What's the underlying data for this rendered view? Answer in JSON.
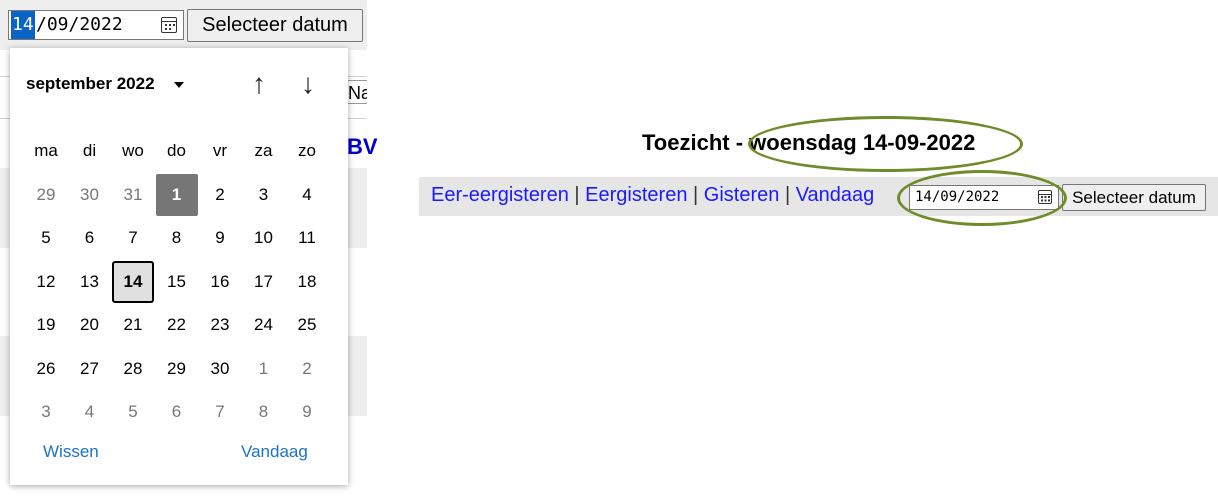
{
  "date_input": {
    "day_segment": "14",
    "rest_segments": "/09/2022"
  },
  "select_button_label": "Selecteer datum",
  "peek_texts": {
    "na": "Na",
    "bw": "BV"
  },
  "calendar": {
    "month_label": "september 2022",
    "weekdays": [
      "ma",
      "di",
      "wo",
      "do",
      "vr",
      "za",
      "zo"
    ],
    "weeks": [
      [
        {
          "d": "29",
          "other": true
        },
        {
          "d": "30",
          "other": true
        },
        {
          "d": "31",
          "other": true
        },
        {
          "d": "1",
          "selected": true
        },
        {
          "d": "2"
        },
        {
          "d": "3"
        },
        {
          "d": "4"
        }
      ],
      [
        {
          "d": "5"
        },
        {
          "d": "6"
        },
        {
          "d": "7"
        },
        {
          "d": "8"
        },
        {
          "d": "9"
        },
        {
          "d": "10"
        },
        {
          "d": "11"
        }
      ],
      [
        {
          "d": "12"
        },
        {
          "d": "13"
        },
        {
          "d": "14",
          "today": true
        },
        {
          "d": "15"
        },
        {
          "d": "16"
        },
        {
          "d": "17"
        },
        {
          "d": "18"
        }
      ],
      [
        {
          "d": "19"
        },
        {
          "d": "20"
        },
        {
          "d": "21"
        },
        {
          "d": "22"
        },
        {
          "d": "23"
        },
        {
          "d": "24"
        },
        {
          "d": "25"
        }
      ],
      [
        {
          "d": "26"
        },
        {
          "d": "27"
        },
        {
          "d": "28"
        },
        {
          "d": "29"
        },
        {
          "d": "30"
        },
        {
          "d": "1",
          "other": true
        },
        {
          "d": "2",
          "other": true
        }
      ],
      [
        {
          "d": "3",
          "other": true
        },
        {
          "d": "4",
          "other": true
        },
        {
          "d": "5",
          "other": true
        },
        {
          "d": "6",
          "other": true
        },
        {
          "d": "7",
          "other": true
        },
        {
          "d": "8",
          "other": true
        },
        {
          "d": "9",
          "other": true
        }
      ]
    ],
    "clear_label": "Wissen",
    "today_label": "Vandaag"
  },
  "page": {
    "title_prefix": "Toezicht - ",
    "title_date": "woensdag 14-09-2022",
    "nav_links": [
      "Eer-eergisteren",
      "Eergisteren",
      "Gisteren",
      "Vandaag"
    ],
    "separator": "|",
    "small_date_value": "14/09/2022",
    "small_button_label": "Selecteer datum"
  },
  "colors": {
    "highlight_ellipse": "#6f8c2a",
    "link": "#1a1aff",
    "selection": "#0a64c8"
  }
}
